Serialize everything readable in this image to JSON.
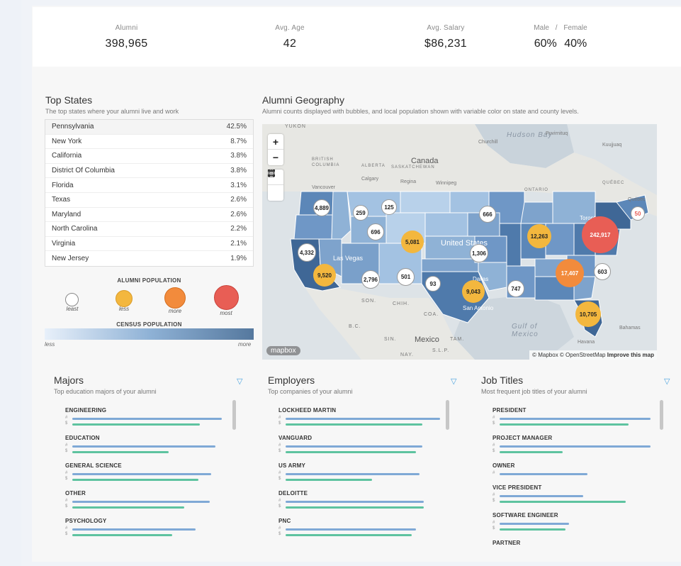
{
  "kpis": {
    "alumni": {
      "label": "Alumni",
      "value": "398,965"
    },
    "age": {
      "label": "Avg. Age",
      "value": "42"
    },
    "salary": {
      "label": "Avg. Salary",
      "value": "$86,231"
    },
    "gender": {
      "male_label": "Male",
      "sep": "/",
      "female_label": "Female",
      "male_value": "60%",
      "female_value": "40%"
    }
  },
  "top_states": {
    "title": "Top States",
    "subtitle": "The top states where your alumni live and work",
    "rows": [
      {
        "state": "Pennsylvania",
        "pct": "42.5%"
      },
      {
        "state": "New York",
        "pct": "8.7%"
      },
      {
        "state": "California",
        "pct": "3.8%"
      },
      {
        "state": "District Of Columbia",
        "pct": "3.8%"
      },
      {
        "state": "Florida",
        "pct": "3.1%"
      },
      {
        "state": "Texas",
        "pct": "2.6%"
      },
      {
        "state": "Maryland",
        "pct": "2.6%"
      },
      {
        "state": "North Carolina",
        "pct": "2.2%"
      },
      {
        "state": "Virginia",
        "pct": "2.1%"
      },
      {
        "state": "New Jersey",
        "pct": "1.9%"
      }
    ],
    "alumni_legend": {
      "title": "ALUMNI POPULATION",
      "least": "least",
      "less": "less",
      "more": "more",
      "most": "most"
    },
    "census_legend": {
      "title": "CENSUS POPULATION",
      "less": "less",
      "more": "more"
    }
  },
  "geo": {
    "title": "Alumni Geography",
    "subtitle": "Alumni counts displayed with bubbles, and local population shown with variable color on state and county levels.",
    "controls": {
      "zoom_in": "+",
      "zoom_out": "−"
    },
    "labels": {
      "hudson_bay": "Hudson Bay",
      "canada": "Canada",
      "united_states": "United States",
      "mexico": "Mexico",
      "gulf": "Gulf of Mexico",
      "las_vegas": "Las Vegas",
      "dallas": "Dallas",
      "san_antonio": "San Antonio",
      "havana": "Havana",
      "bahamas": "Bahamas",
      "toronto": "Toronto",
      "quebec": "Québec",
      "winnipeg": "Winnipeg",
      "regina": "Regina",
      "calgary": "Calgary",
      "vancouver": "Vancouver",
      "ontario": "ONTARIO",
      "british_columbia": "BRITISH COLUMBIA",
      "alberta": "ALBERTA",
      "saskatchewan": "SASKATCHEWAN",
      "quebec_prov": "QUÉBEC",
      "yukon": "YUKON",
      "churchill": "Churchill",
      "puvirnituq": "Puvirnituq",
      "kuujjuaq": "Kuujjuaq",
      "son": "SON.",
      "chih": "CHIH.",
      "coa": "COA.",
      "bc_mx": "B.C.",
      "sin": "SIN.",
      "tam": "TAM.",
      "slp": "S.L.P.",
      "nay": "NAY."
    },
    "bubbles": [
      {
        "id": "wa",
        "value": "4,889"
      },
      {
        "id": "id",
        "value": "259"
      },
      {
        "id": "mt",
        "value": "125"
      },
      {
        "id": "ut",
        "value": "696"
      },
      {
        "id": "co",
        "value": "5,081"
      },
      {
        "id": "ca_n",
        "value": "4,332"
      },
      {
        "id": "ca_s",
        "value": "9,520"
      },
      {
        "id": "az",
        "value": "2,796"
      },
      {
        "id": "nm",
        "value": "501"
      },
      {
        "id": "ok",
        "value": "93"
      },
      {
        "id": "tx",
        "value": "9,043"
      },
      {
        "id": "ks",
        "value": "1,306"
      },
      {
        "id": "mn",
        "value": "666"
      },
      {
        "id": "il",
        "value": "12,263"
      },
      {
        "id": "pa",
        "value": "242,917"
      },
      {
        "id": "nc",
        "value": "17,407"
      },
      {
        "id": "va",
        "value": "603"
      },
      {
        "id": "ms",
        "value": "747"
      },
      {
        "id": "fl",
        "value": "10,705"
      },
      {
        "id": "me",
        "value": "50"
      }
    ],
    "mapbox": "mapbox",
    "attribution": {
      "text": "© Mapbox © OpenStreetMap",
      "link": "Improve this map"
    }
  },
  "majors": {
    "title": "Majors",
    "subtitle": "Top education majors of your alumni",
    "items": [
      {
        "name": "ENGINEERING",
        "count": 0.96,
        "salary": 0.82
      },
      {
        "name": "EDUCATION",
        "count": 0.92,
        "salary": 0.62
      },
      {
        "name": "GENERAL SCIENCE",
        "count": 0.89,
        "salary": 0.81
      },
      {
        "name": "OTHER",
        "count": 0.88,
        "salary": 0.72
      },
      {
        "name": "PSYCHOLOGY",
        "count": 0.79,
        "salary": 0.64
      }
    ]
  },
  "employers": {
    "title": "Employers",
    "subtitle": "Top companies of your alumni",
    "items": [
      {
        "name": "LOCKHEED MARTIN",
        "count": 0.98,
        "salary": 0.87
      },
      {
        "name": "VANGUARD",
        "count": 0.87,
        "salary": 0.83
      },
      {
        "name": "US ARMY",
        "count": 0.85,
        "salary": 0.55
      },
      {
        "name": "DELOITTE",
        "count": 0.88,
        "salary": 0.88
      },
      {
        "name": "PNC",
        "count": 0.83,
        "salary": 0.8
      }
    ]
  },
  "job_titles": {
    "title": "Job Titles",
    "subtitle": "Most frequent job titles of your alumni",
    "items": [
      {
        "name": "PRESIDENT",
        "count": 0.96,
        "salary": 0.82
      },
      {
        "name": "PROJECT MANAGER",
        "count": 0.96,
        "salary": 0.4
      },
      {
        "name": "OWNER",
        "count": 0.56,
        "salary": null
      },
      {
        "name": "VICE PRESIDENT",
        "count": 0.53,
        "salary": 0.8
      },
      {
        "name": "SOFTWARE ENGINEER",
        "count": 0.44,
        "salary": 0.42
      },
      {
        "name": "PARTNER",
        "count": null,
        "salary": null
      }
    ]
  }
}
